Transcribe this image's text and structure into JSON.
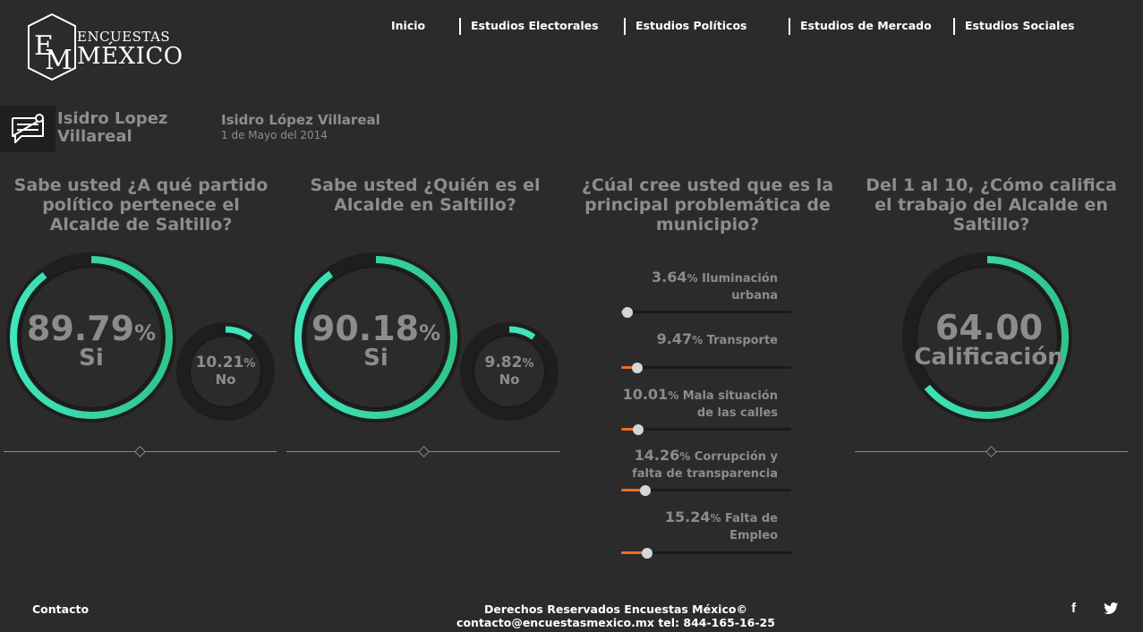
{
  "brand": {
    "line1": "ENCUESTAS",
    "line2": "MÉXICO",
    "monogram": "EM"
  },
  "nav": [
    {
      "label": "Inicio"
    },
    {
      "label": "Estudios Electorales"
    },
    {
      "label": "Estudios Políticos"
    },
    {
      "label": "Estudios de Mercado"
    },
    {
      "label": "Estudios Sociales"
    }
  ],
  "article": {
    "icon": "message-icon",
    "author_name": "Isidro Lopez Villareal",
    "title": "Isidro López Villareal",
    "date": "1 de Mayo del 2014"
  },
  "questions": [
    {
      "text": "Sabe usted ¿A qué partido político pertenece el Alcalde de Saltillo?",
      "main": {
        "value": "89.79",
        "unit": "%",
        "label": "Si",
        "fraction": 0.8979
      },
      "secondary": {
        "value": "10.21",
        "unit": "%",
        "label": "No",
        "fraction": 0.1021
      }
    },
    {
      "text": "Sabe usted ¿Quién es el Alcalde en Saltillo?",
      "main": {
        "value": "90.18",
        "unit": "%",
        "label": "Si",
        "fraction": 0.9018
      },
      "secondary": {
        "value": "9.82",
        "unit": "%",
        "label": "No",
        "fraction": 0.0982
      }
    },
    {
      "text": "¿Cúal cree usted que es la principal problemática de municipio?",
      "items": [
        {
          "value": "3.64",
          "unit": "%",
          "label": "Iluminación urbana",
          "fraction": 0.0364
        },
        {
          "value": "9.47",
          "unit": "%",
          "label": "Transporte",
          "fraction": 0.0947
        },
        {
          "value": "10.01",
          "unit": "%",
          "label": "Mala situación de las calles",
          "fraction": 0.1001
        },
        {
          "value": "14.26",
          "unit": "%",
          "label": "Corrupción y falta de transparencia",
          "fraction": 0.1426
        },
        {
          "value": "15.24",
          "unit": "%",
          "label": "Falta de Empleo",
          "fraction": 0.1524
        }
      ]
    },
    {
      "text": "Del 1 al 10, ¿Cómo califica el trabajo del Alcalde en Saltillo?",
      "main": {
        "value": "64.00",
        "label": "Calificación",
        "fraction": 0.64
      }
    }
  ],
  "footer": {
    "contact": "Contacto",
    "copyright": "Derechos Reservados Encuestas México© contacto@encuestasmexico.mx tel: 844-165-16-25",
    "social": [
      "facebook-icon",
      "twitter-icon"
    ],
    "facebook_glyph": "f"
  },
  "colors": {
    "background": "#2b2b2b",
    "ring_track": "#1e1e1e",
    "ring_start": "#3fe5bd",
    "ring_end": "#2fc48a",
    "slider_fill": "#f26a22",
    "text_muted": "#8c8c8c"
  }
}
